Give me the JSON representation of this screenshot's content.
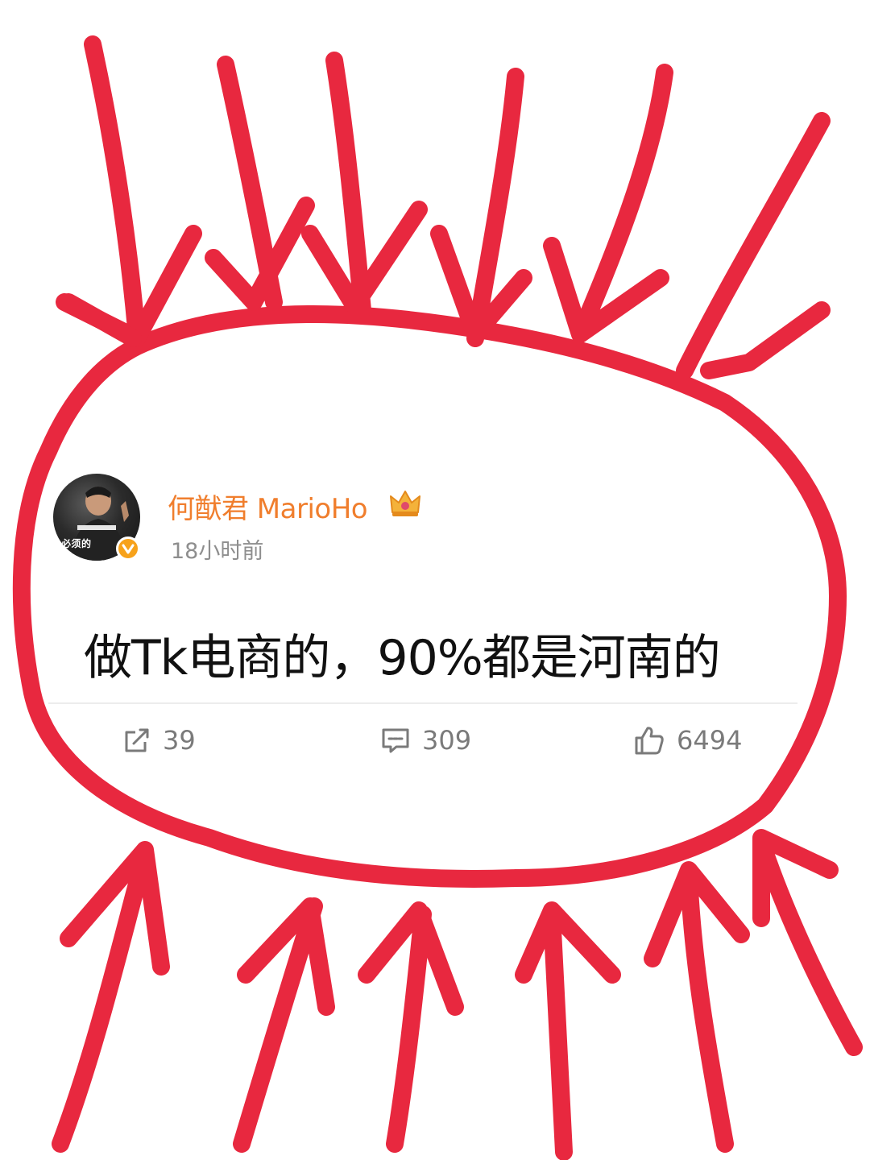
{
  "post": {
    "author": {
      "name": "何猷君 MarioHo",
      "avatar_text": "必须的",
      "verified_icon": "verified-v-icon",
      "vip_icon": "crown-icon"
    },
    "timestamp": "18小时前",
    "content": "做Tk电商的，90%都是河南的",
    "actions": {
      "repost_count": "39",
      "comment_count": "309",
      "like_count": "6494"
    }
  },
  "colors": {
    "username": "#f07e2d",
    "verified_badge": "#f7a21b",
    "annotation_red": "#e8283f",
    "meta_gray": "#8e8e8e",
    "action_gray": "#7a7a7a"
  },
  "annotation": {
    "shape": "hand-drawn circle with arrows pointing inward"
  }
}
